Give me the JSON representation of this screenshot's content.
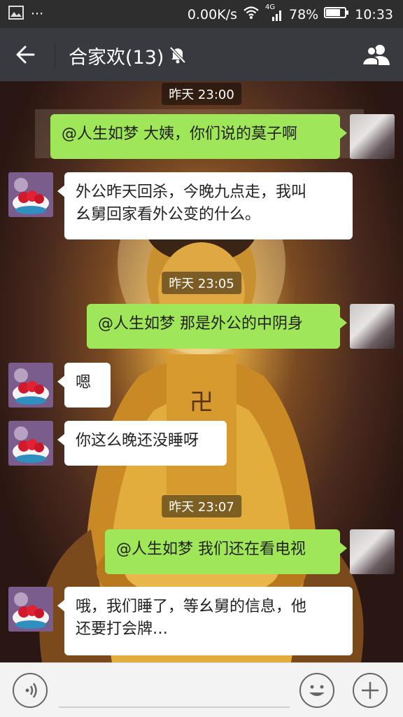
{
  "status": {
    "speed": "0.00K/s",
    "network": "4G",
    "battery": "78%",
    "time": "10:33"
  },
  "header": {
    "title": "合家欢(13)"
  },
  "messages": {
    "t1": "昨天 23:00",
    "m1": "@人生如梦 大姨，你们说的莫子啊",
    "m2_line1": "外公昨天回杀，今晚九点走，我叫",
    "m2_line2": "幺舅回家看外公变的什么。",
    "t2": "昨天 23:05",
    "m3": "@人生如梦 那是外公的中阴身",
    "m4": "嗯",
    "m5": "你这么晚还没睡呀",
    "t3": "昨天 23:07",
    "m6": "@人生如梦 我们还在看电视",
    "m7_line1": "哦，我们睡了，等幺舅的信息，他",
    "m7_line2": "还要打会牌…"
  },
  "colors": {
    "header_bg": "#393a3f",
    "statusbar_bg": "#2e2e2e",
    "bubble_green": "#9fe658",
    "bubble_white": "#ffffff"
  }
}
